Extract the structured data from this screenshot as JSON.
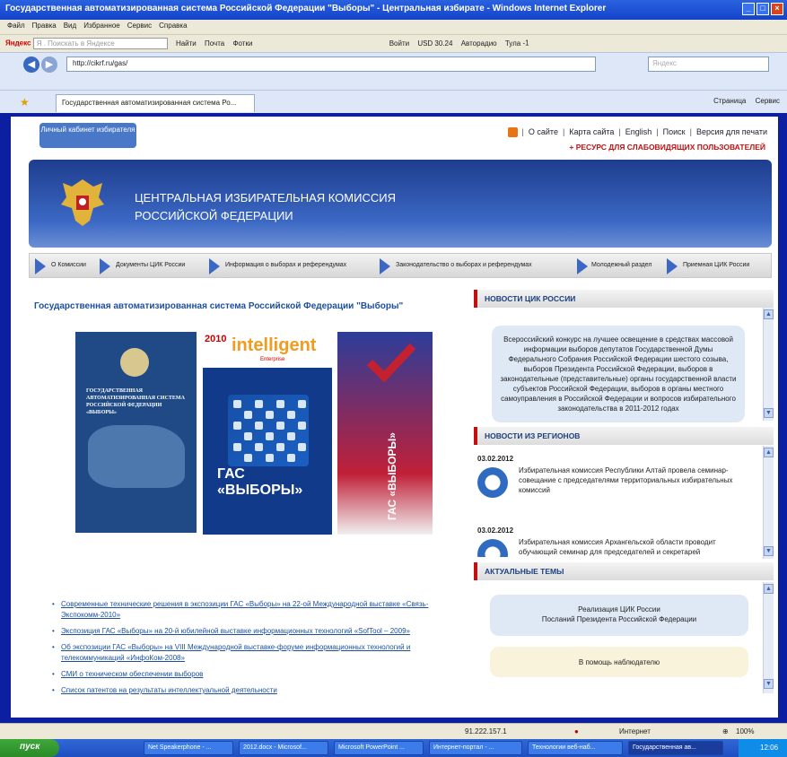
{
  "window": {
    "title": "Государственная автоматизированная система Российской Федерации \"Выборы\" - Центральная избирате - Windows Internet Explorer"
  },
  "menu": [
    "Файл",
    "Правка",
    "Вид",
    "Избранное",
    "Сервис",
    "Справка"
  ],
  "yandex_bar": {
    "logo": "Яндекс",
    "search_placeholder": "Я . Поискать в Яндексе",
    "find": "Найти",
    "mail": "Почта",
    "photo": "Фотки",
    "login": "Войти",
    "usd": "USD 30.24",
    "autoradio": "Авторадио",
    "city": "Тула",
    "temp": "-1"
  },
  "address": {
    "url": "http://cikrf.ru/gas/",
    "search_placeholder": "Яндекс"
  },
  "tab": {
    "title": "Государственная автоматизированная система Ро..."
  },
  "tab_tools": {
    "page": "Страница",
    "service": "Сервис"
  },
  "site": {
    "cabinet": "Личный кабинет избирателя",
    "top_links": [
      "О сайте",
      "Карта сайта",
      "English",
      "Поиск",
      "Версия для печати"
    ],
    "accessibility": "+ РЕСУРС ДЛЯ СЛАБОВИДЯЩИХ ПОЛЬЗОВАТЕЛЕЙ",
    "org_line1": "ЦЕНТРАЛЬНАЯ ИЗБИРАТЕЛЬНАЯ КОМИССИЯ",
    "org_line2": "РОССИЙСКОЙ ФЕДЕРАЦИИ",
    "nav": [
      "О Комиссии",
      "Документы ЦИК России",
      "Информация о выборах и референдумах",
      "Законодательство о выборах и референдумах",
      "Молодежный раздел",
      "Приемная ЦИК России"
    ]
  },
  "main": {
    "title": "Государственная автоматизированная система Российской Федерации \"Выборы\"",
    "cover1_text": "ГОСУДАРСТВЕННАЯ АВТОМАТИЗИРОВАННАЯ СИСТЕМА РОССИЙСКОЙ ФЕДЕРАЦИИ «ВЫБОРЫ»",
    "cover2_year": "2010",
    "cover2_brand": "intelligent",
    "cover2_sub": "Enterprise",
    "cover2_gas": "ГАС «ВЫБОРЫ»",
    "cover3_gas": "ГАС «ВЫБОРЫ»",
    "links": [
      "Современные технические решения в экспозиции ГАС «Выборы» на 22-ой Международной выставке «Связь-Экспокомм-2010»",
      "Экспозиция ГАС «Выборы» на 20-й юбилейной выставке информационных технологий «SofTool – 2009»",
      "Об экспозиции ГАС «Выборы» на VIII Международной выставке-форуме информационных технологий и телекоммуникаций «ИнфоКом-2008»",
      "СМИ о техническом обеспечении выборов",
      "Список патентов на результаты интеллектуальной деятельности"
    ]
  },
  "sidebar": {
    "news_title": "НОВОСТИ ЦИК РОССИИ",
    "news_text": "Всероссийский конкурс на лучшее освещение в средствах массовой информации выборов депутатов Государственной Думы Федерального Собрания Российской Федерации шестого созыва, выборов Президента Российской Федерации, выборов в законодательные (представительные) органы государственной власти субъектов Российской Федерации, выборов в органы местного самоуправления в Российской Федерации и вопросов избирательного законодательства в 2011-2012 годах",
    "regions_title": "НОВОСТИ ИЗ РЕГИОНОВ",
    "regions": [
      {
        "date": "03.02.2012",
        "text": "Избирательная комиссия Республики Алтай провела семинар-совещание с председателями территориальных избирательных комиссий"
      },
      {
        "date": "03.02.2012",
        "text": "Избирательная комиссия Архангельской области проводит обучающий семинар для председателей и секретарей"
      }
    ],
    "topics_title": "АКТУАЛЬНЫЕ ТЕМЫ",
    "topic1_line1": "Реализация ЦИК России",
    "topic1_line2": "Посланий Президента Российской Федерации",
    "topic2": "В помощь наблюдателю"
  },
  "status": {
    "ip": "91.222.157.1",
    "zone": "Интернет",
    "zoom": "100%"
  },
  "taskbar": {
    "start": "пуск",
    "tasks": [
      "Net Speakerphone - ...",
      "2012.docx - Microsof...",
      "Microsoft PowerPoint ...",
      "Интернет-портал - ...",
      "Технологии веб-наб...",
      "Государственная ав..."
    ],
    "clock": "12:06"
  }
}
